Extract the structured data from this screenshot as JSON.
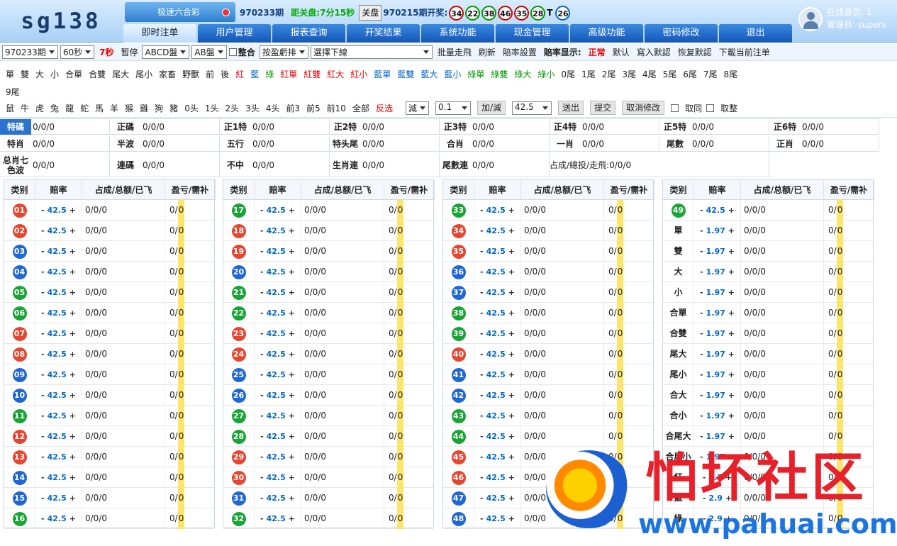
{
  "logo": "sg138",
  "game": "极速六合彩",
  "period_info": {
    "period": "970233期",
    "countdown_label": "距关盘:",
    "countdown": "7分15秒",
    "close_btn": "关盘",
    "last_period": "970215期开奖:",
    "balls": [
      {
        "n": "34",
        "c": "r"
      },
      {
        "n": "22",
        "c": "g"
      },
      {
        "n": "38",
        "c": "g"
      },
      {
        "n": "46",
        "c": "r"
      },
      {
        "n": "35",
        "c": "r"
      },
      {
        "n": "28",
        "c": "g"
      }
    ],
    "t_label": "T",
    "special_ball": {
      "n": "26",
      "c": "b"
    }
  },
  "nav": [
    "即时注单",
    "用户管理",
    "报表查询",
    "开奖结果",
    "系统功能",
    "现金管理",
    "高级功能",
    "密码修改",
    "退出"
  ],
  "user": {
    "online_label": "在线会员:",
    "online_count": "1",
    "admin_label": "管理员:",
    "admin_name": "supers"
  },
  "toolbar": {
    "period_select": "970233期",
    "interval_select": "60秒",
    "seconds": "7秒",
    "pause": "暂停",
    "plate1": "ABCD盤",
    "plate2": "AB盤",
    "merge_label": "整合",
    "sort_select": "按盈虧排",
    "line_select": "選擇下線",
    "buttons": [
      "批量走飛",
      "刷新",
      "賠率設置"
    ],
    "odds_display_label": "賠率显示:",
    "odds_normal": "正常",
    "buttons2": [
      "默认",
      "寫入默認",
      "恢复默認",
      "下載当前注单"
    ]
  },
  "quick": {
    "row1": [
      {
        "t": "單"
      },
      {
        "t": "雙"
      },
      {
        "t": "大"
      },
      {
        "t": "小"
      },
      {
        "t": "合單"
      },
      {
        "t": "合雙"
      },
      {
        "t": "尾大"
      },
      {
        "t": "尾小"
      },
      {
        "t": "家畜"
      },
      {
        "t": "野獸"
      },
      {
        "t": "前"
      },
      {
        "t": "後"
      },
      {
        "t": "紅",
        "c": "red"
      },
      {
        "t": "藍",
        "c": "blu"
      },
      {
        "t": "綠",
        "c": "grn"
      },
      {
        "t": "紅單",
        "c": "red"
      },
      {
        "t": "紅雙",
        "c": "red"
      },
      {
        "t": "紅大",
        "c": "red"
      },
      {
        "t": "紅小",
        "c": "red"
      },
      {
        "t": "藍單",
        "c": "blu"
      },
      {
        "t": "藍雙",
        "c": "blu"
      },
      {
        "t": "藍大",
        "c": "blu"
      },
      {
        "t": "藍小",
        "c": "blu"
      },
      {
        "t": "綠單",
        "c": "grn"
      },
      {
        "t": "綠雙",
        "c": "grn"
      },
      {
        "t": "綠大",
        "c": "grn"
      },
      {
        "t": "綠小",
        "c": "grn"
      },
      {
        "t": "0尾"
      },
      {
        "t": "1尾"
      },
      {
        "t": "2尾"
      },
      {
        "t": "3尾"
      },
      {
        "t": "4尾"
      },
      {
        "t": "5尾"
      },
      {
        "t": "6尾"
      },
      {
        "t": "7尾"
      },
      {
        "t": "8尾"
      }
    ],
    "row2": [
      {
        "t": "9尾"
      }
    ],
    "row3": [
      {
        "t": "鼠"
      },
      {
        "t": "牛"
      },
      {
        "t": "虎"
      },
      {
        "t": "兔"
      },
      {
        "t": "龍"
      },
      {
        "t": "蛇"
      },
      {
        "t": "馬"
      },
      {
        "t": "羊"
      },
      {
        "t": "猴"
      },
      {
        "t": "雞"
      },
      {
        "t": "狗"
      },
      {
        "t": "豬"
      },
      {
        "t": "0头"
      },
      {
        "t": "1头"
      },
      {
        "t": "2头"
      },
      {
        "t": "3头"
      },
      {
        "t": "4头"
      },
      {
        "t": "前3"
      },
      {
        "t": "前5"
      },
      {
        "t": "前10"
      },
      {
        "t": "全部"
      },
      {
        "t": "反选",
        "c": "red"
      }
    ],
    "op_select": "減",
    "step_select": "0.1",
    "adjust_btn": "加/減",
    "odds_input": "42.5",
    "send_btn": "送出",
    "submit_btn": "提交",
    "cancel_btn": "取消修改",
    "same_label": "取同",
    "round_label": "取整"
  },
  "summary": [
    {
      "k": "特碼",
      "v": "0/0/0"
    },
    {
      "k": "正碼",
      "v": "0/0/0"
    },
    {
      "k": "正1特",
      "v": "0/0/0"
    },
    {
      "k": "正2特",
      "v": "0/0/0"
    },
    {
      "k": "正3特",
      "v": "0/0/0"
    },
    {
      "k": "正4特",
      "v": "0/0/0"
    },
    {
      "k": "正5特",
      "v": "0/0/0"
    },
    {
      "k": "正6特",
      "v": "0/0/0"
    },
    {
      "k": "特肖",
      "v": "0/0/0"
    },
    {
      "k": "半波",
      "v": "0/0/0"
    },
    {
      "k": "五行",
      "v": "0/0/0"
    },
    {
      "k": "特头尾",
      "v": "0/0/0"
    },
    {
      "k": "合肖",
      "v": "0/0/0"
    },
    {
      "k": "一肖",
      "v": "0/0/0"
    },
    {
      "k": "尾數",
      "v": "0/0/0"
    },
    {
      "k": "正肖",
      "v": "0/0/0"
    },
    {
      "k": "总肖七色波",
      "v": "0/0/0"
    },
    {
      "k": "連碼",
      "v": "0/0/0"
    },
    {
      "k": "不中",
      "v": "0/0/0"
    },
    {
      "k": "生肖連",
      "v": "0/0/0"
    },
    {
      "k": "尾數連",
      "v": "0/0/0"
    },
    {
      "k": "",
      "v": "占成/總投/走飛:0/0/0"
    }
  ],
  "table_headers": [
    "类别",
    "赔率",
    "占成/总额/已飞",
    "盈亏/需补"
  ],
  "row_values": {
    "odds": "42.5",
    "amount": "0/0/0",
    "pl": "0/",
    "pl_hl": "0",
    "minus": "-",
    "plus": "+"
  },
  "numbers": [
    [
      {
        "n": "01",
        "c": "r"
      },
      {
        "n": "02",
        "c": "r"
      },
      {
        "n": "03",
        "c": "b"
      },
      {
        "n": "04",
        "c": "b"
      },
      {
        "n": "05",
        "c": "g"
      },
      {
        "n": "06",
        "c": "g"
      },
      {
        "n": "07",
        "c": "r"
      },
      {
        "n": "08",
        "c": "r"
      },
      {
        "n": "09",
        "c": "b"
      },
      {
        "n": "10",
        "c": "b"
      },
      {
        "n": "11",
        "c": "g"
      },
      {
        "n": "12",
        "c": "r"
      },
      {
        "n": "13",
        "c": "r"
      },
      {
        "n": "14",
        "c": "b"
      },
      {
        "n": "15",
        "c": "b"
      },
      {
        "n": "16",
        "c": "g"
      }
    ],
    [
      {
        "n": "17",
        "c": "g"
      },
      {
        "n": "18",
        "c": "r"
      },
      {
        "n": "19",
        "c": "r"
      },
      {
        "n": "20",
        "c": "b"
      },
      {
        "n": "21",
        "c": "g"
      },
      {
        "n": "22",
        "c": "g"
      },
      {
        "n": "23",
        "c": "r"
      },
      {
        "n": "24",
        "c": "r"
      },
      {
        "n": "25",
        "c": "b"
      },
      {
        "n": "26",
        "c": "b"
      },
      {
        "n": "27",
        "c": "g"
      },
      {
        "n": "28",
        "c": "g"
      },
      {
        "n": "29",
        "c": "r"
      },
      {
        "n": "30",
        "c": "r"
      },
      {
        "n": "31",
        "c": "b"
      },
      {
        "n": "32",
        "c": "g"
      }
    ],
    [
      {
        "n": "33",
        "c": "g"
      },
      {
        "n": "34",
        "c": "r"
      },
      {
        "n": "35",
        "c": "r"
      },
      {
        "n": "36",
        "c": "b"
      },
      {
        "n": "37",
        "c": "b"
      },
      {
        "n": "38",
        "c": "g"
      },
      {
        "n": "39",
        "c": "g"
      },
      {
        "n": "40",
        "c": "r"
      },
      {
        "n": "41",
        "c": "b"
      },
      {
        "n": "42",
        "c": "b"
      },
      {
        "n": "43",
        "c": "g"
      },
      {
        "n": "44",
        "c": "g"
      },
      {
        "n": "45",
        "c": "r"
      },
      {
        "n": "46",
        "c": "r"
      },
      {
        "n": "47",
        "c": "b"
      },
      {
        "n": "48",
        "c": "b"
      }
    ]
  ],
  "col4": [
    {
      "n": "49",
      "c": "g",
      "odds": "42.5"
    },
    {
      "t": "單",
      "odds": "1.97"
    },
    {
      "t": "雙",
      "odds": "1.97"
    },
    {
      "t": "大",
      "odds": "1.97"
    },
    {
      "t": "小",
      "odds": "1.97"
    },
    {
      "t": "合單",
      "odds": "1.97"
    },
    {
      "t": "合雙",
      "odds": "1.97"
    },
    {
      "t": "尾大",
      "odds": "1.97"
    },
    {
      "t": "尾小",
      "odds": "1.97"
    },
    {
      "t": "合大",
      "odds": "1.97"
    },
    {
      "t": "合小",
      "odds": "1.97"
    },
    {
      "t": "合尾大",
      "odds": "1.97"
    },
    {
      "t": "合尾小",
      "odds": "1.97"
    },
    {
      "t": "紅",
      "odds": "2.7"
    },
    {
      "t": "藍",
      "odds": "2.9"
    },
    {
      "t": "綠",
      "odds": "2.9"
    }
  ],
  "watermark": {
    "cn": "怕坏社区",
    "url": "www.pahuai.com"
  }
}
